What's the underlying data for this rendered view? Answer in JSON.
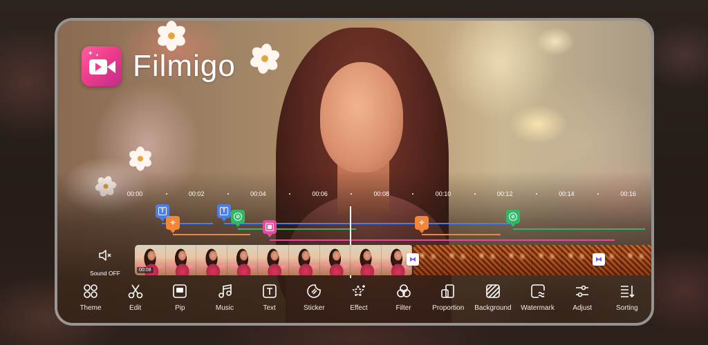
{
  "app": {
    "name": "Filmigo",
    "logo_icon": "video-camera-icon"
  },
  "timeline": {
    "ruler_labels": [
      "00:00",
      "00:02",
      "00:04",
      "00:06",
      "00:08",
      "00:10",
      "00:12",
      "00:14",
      "00:16"
    ],
    "playhead_time_sec": 6.9,
    "markers": [
      {
        "type": "text",
        "color": "#4d7ee8",
        "icon": "text-icon",
        "start_sec": 0.9
      },
      {
        "type": "effect",
        "color": "#f1863a",
        "icon": "effect-icon",
        "start_sec": 1.2
      },
      {
        "type": "text",
        "color": "#4d7ee8",
        "icon": "text-icon",
        "start_sec": 3.0
      },
      {
        "type": "sticker",
        "color": "#2fb866",
        "icon": "sticker-icon",
        "start_sec": 3.4
      },
      {
        "type": "pip",
        "color": "#e64a9e",
        "icon": "pip-icon",
        "start_sec": 4.4
      },
      {
        "type": "effect",
        "color": "#f1863a",
        "icon": "effect-icon",
        "start_sec": 9.5
      },
      {
        "type": "sticker",
        "color": "#2fb866",
        "icon": "sticker-icon",
        "start_sec": 12.2
      }
    ],
    "sound": {
      "icon": "speaker-muted-icon",
      "label": "Sound OFF"
    },
    "clips": [
      {
        "duration_label": "00:08"
      },
      {
        "duration_label": ""
      }
    ],
    "transition_icon": "transition-icon"
  },
  "toolbar": {
    "items": [
      {
        "label": "Theme",
        "icon": "theme-icon"
      },
      {
        "label": "Edit",
        "icon": "scissors-icon"
      },
      {
        "label": "Pip",
        "icon": "pip-icon"
      },
      {
        "label": "Music",
        "icon": "music-note-icon"
      },
      {
        "label": "Text",
        "icon": "text-icon"
      },
      {
        "label": "Sticker",
        "icon": "sticker-icon"
      },
      {
        "label": "Effect",
        "icon": "effect-star-icon"
      },
      {
        "label": "Filter",
        "icon": "filter-icon"
      },
      {
        "label": "Proportion",
        "icon": "proportion-icon"
      },
      {
        "label": "Background",
        "icon": "background-icon"
      },
      {
        "label": "Watermark",
        "icon": "watermark-icon"
      },
      {
        "label": "Adjust",
        "icon": "adjust-sliders-icon"
      },
      {
        "label": "Sorting",
        "icon": "sorting-icon"
      }
    ]
  },
  "colors": {
    "brand_pink": "#ee3c8c",
    "text_track": "#4d7ee8",
    "effect_track": "#f1863a",
    "sticker_track": "#2fb866",
    "pip_track": "#e64a9e",
    "transition_accent": "#7b59f0"
  }
}
